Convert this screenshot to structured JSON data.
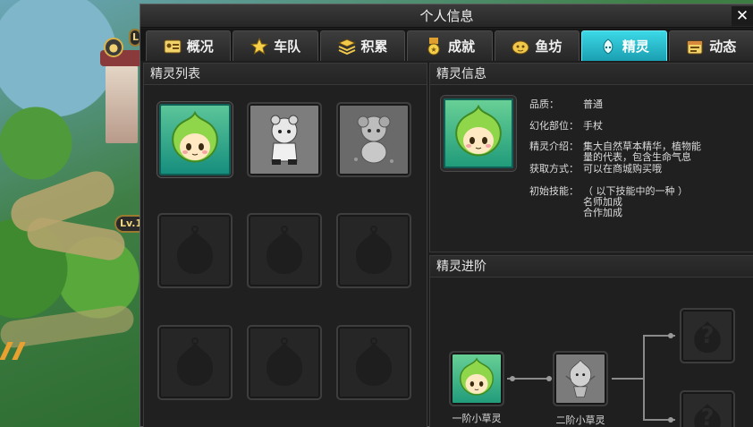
{
  "map": {
    "levels": [
      "L",
      "Lv.1"
    ]
  },
  "window": {
    "title": "个人信息",
    "close": "✕"
  },
  "tabs": [
    {
      "label": "概况",
      "icon": "id-card-icon",
      "active": false
    },
    {
      "label": "车队",
      "icon": "star-icon",
      "active": false
    },
    {
      "label": "积累",
      "icon": "stack-icon",
      "active": false
    },
    {
      "label": "成就",
      "icon": "medal-icon",
      "active": false
    },
    {
      "label": "鱼坊",
      "icon": "fish-bag-icon",
      "active": false
    },
    {
      "label": "精灵",
      "icon": "sprite-icon",
      "active": true
    },
    {
      "label": "动态",
      "icon": "calendar-icon",
      "active": false
    }
  ],
  "sprite_list": {
    "title": "精灵列表",
    "slots": [
      {
        "state": "owned",
        "name": "一阶小草灵"
      },
      {
        "state": "locked-sprite"
      },
      {
        "state": "locked-sprite"
      },
      {
        "state": "empty"
      },
      {
        "state": "empty"
      },
      {
        "state": "empty"
      },
      {
        "state": "empty"
      },
      {
        "state": "empty"
      },
      {
        "state": "empty"
      }
    ]
  },
  "sprite_info": {
    "title": "精灵信息",
    "quality_label": "品质：",
    "quality_value": "普通",
    "part_label": "幻化部位：",
    "part_value": "手杖",
    "intro_label": "精灵介绍：",
    "intro_value": "集大自然草本精华，植物能量的代表，包含生命气息",
    "obtain_label": "获取方式：",
    "obtain_value": "可以在商城购买哦",
    "skill_label": "初始技能：",
    "skill_header": "（ 以下技能中的一种 ）",
    "skills": [
      "名师加成",
      "合作加成"
    ]
  },
  "advance": {
    "title": "精灵进阶",
    "stage1": "一阶小草灵",
    "stage2": "二阶小草灵",
    "unknown_mark": "?"
  }
}
